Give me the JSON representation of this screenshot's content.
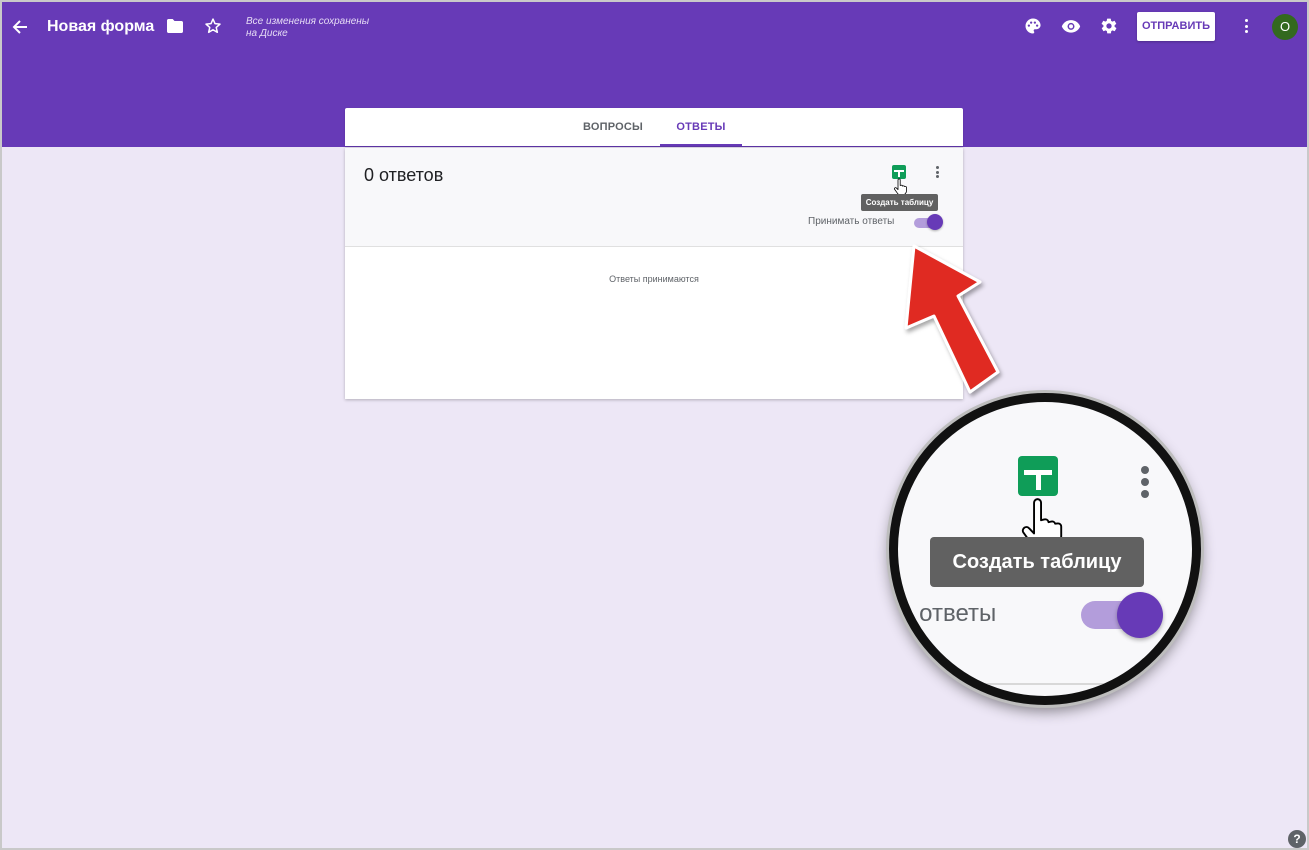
{
  "header": {
    "title": "Новая форма",
    "saved_status_line1": "Все изменения сохранены",
    "saved_status_line2": "на Диске",
    "send_label": "ОТПРАВИТЬ",
    "avatar_initial": "О",
    "background_color": "#673ab7"
  },
  "tabs": [
    {
      "label": "ВОПРОСЫ",
      "active": false
    },
    {
      "label": "ОТВЕТЫ",
      "active": true
    }
  ],
  "responses": {
    "count_text": "0 ответов",
    "tooltip": "Создать таблицу",
    "accept_label": "Принимать ответы",
    "accepting": true,
    "status_text": "Ответы принимаются"
  },
  "magnifier": {
    "tooltip": "Создать таблицу",
    "label_fragment": "ь ответы"
  },
  "icons": [
    "back-arrow-icon",
    "folder-icon",
    "star-icon",
    "palette-icon",
    "eye-icon",
    "gear-icon",
    "more-vert-icon",
    "sheets-icon",
    "hand-cursor-icon",
    "help-icon"
  ],
  "colors": {
    "accent": "#673ab7",
    "sheets_green": "#0f9d58",
    "annotation_arrow": "#e53935",
    "page_background": "#ede7f6"
  },
  "help_glyph": "?"
}
